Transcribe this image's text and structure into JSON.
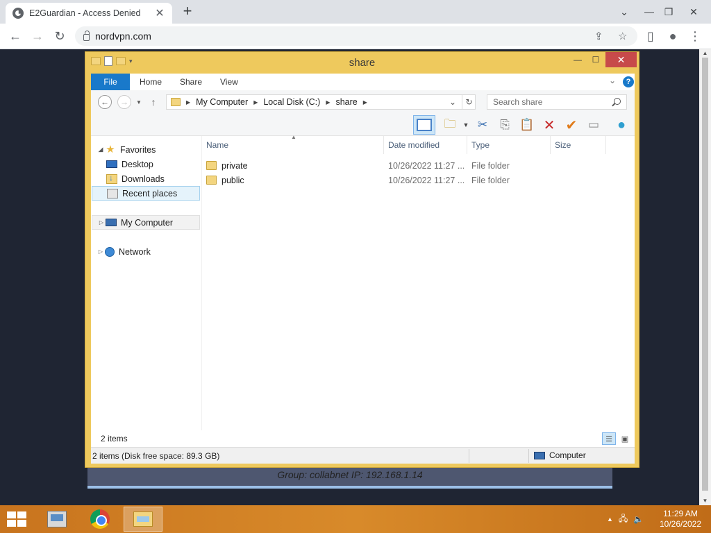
{
  "browser": {
    "tab_title": "E2Guardian - Access Denied",
    "url": "nordvpn.com"
  },
  "page": {
    "info_text": "Group: collabnet   IP: 192.168.1.14"
  },
  "explorer": {
    "title": "share",
    "ribbon_tabs": [
      "File",
      "Home",
      "Share",
      "View"
    ],
    "breadcrumb": [
      "My Computer",
      "Local Disk (C:)",
      "share"
    ],
    "search_placeholder": "Search share",
    "nav": {
      "favorites": "Favorites",
      "desktop": "Desktop",
      "downloads": "Downloads",
      "recent": "Recent places",
      "computer": "My Computer",
      "network": "Network"
    },
    "columns": [
      "Name",
      "Date modified",
      "Type",
      "Size"
    ],
    "files": [
      {
        "name": "private",
        "date": "10/26/2022 11:27 ...",
        "type": "File folder"
      },
      {
        "name": "public",
        "date": "10/26/2022 11:27 ...",
        "type": "File folder"
      }
    ],
    "item_count": "2 items",
    "status_left": "2 items (Disk free space: 89.3 GB)",
    "status_right": "Computer"
  },
  "taskbar": {
    "time": "11:29 AM",
    "date": "10/26/2022"
  },
  "colors": {
    "window_frame": "#eec95d",
    "file_tab": "#1979ca",
    "taskbar": "#d88a2a",
    "close_button": "#c74a4a"
  }
}
